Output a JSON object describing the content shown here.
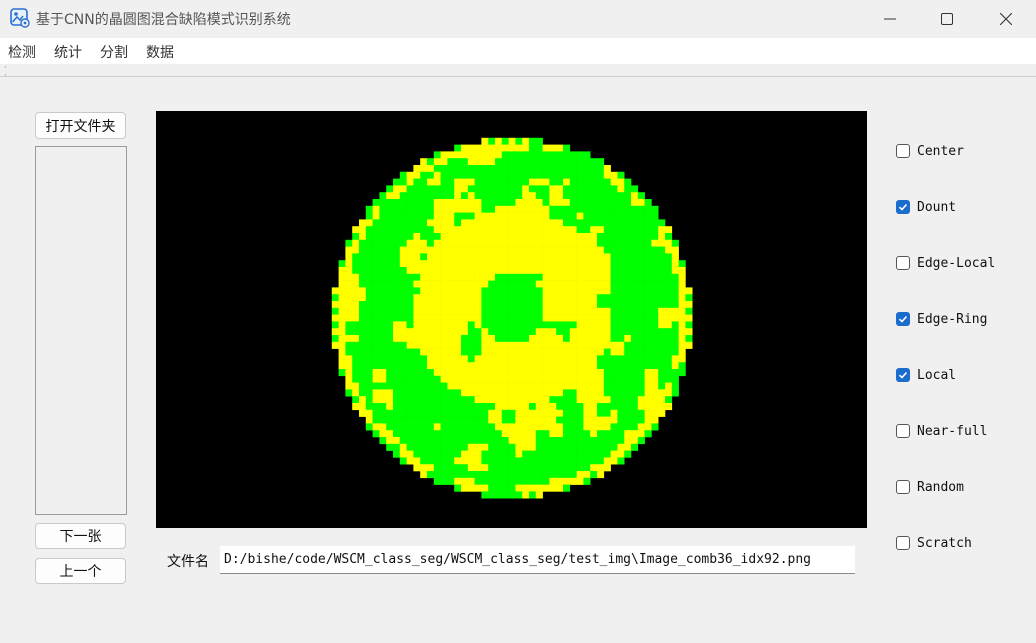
{
  "window": {
    "title": "基于CNN的晶圆图混合缺陷模式识别系统",
    "controls": [
      "minimize",
      "maximize",
      "close"
    ]
  },
  "menu": [
    "检测",
    "统计",
    "分割",
    "数据"
  ],
  "left_panel": {
    "open_folder_label": "打开文件夹",
    "next_label": "下一张",
    "prev_label": "上一个"
  },
  "file_name": {
    "label": "文件名",
    "value": "D:/bishe/code/WSCM_class_seg/WSCM_class_seg/test_img\\Image_comb36_idx92.png"
  },
  "wafer_colors": {
    "background": "#000000",
    "normal": "#00ff00",
    "defect": "#ffff00"
  },
  "defect_types": [
    {
      "label": "Center",
      "checked": false
    },
    {
      "label": "Dount",
      "checked": true
    },
    {
      "label": "Edge-Local",
      "checked": false
    },
    {
      "label": "Edge-Ring",
      "checked": true
    },
    {
      "label": "Local",
      "checked": true
    },
    {
      "label": "Near-full",
      "checked": false
    },
    {
      "label": "Random",
      "checked": false
    },
    {
      "label": "Scratch",
      "checked": false
    }
  ]
}
